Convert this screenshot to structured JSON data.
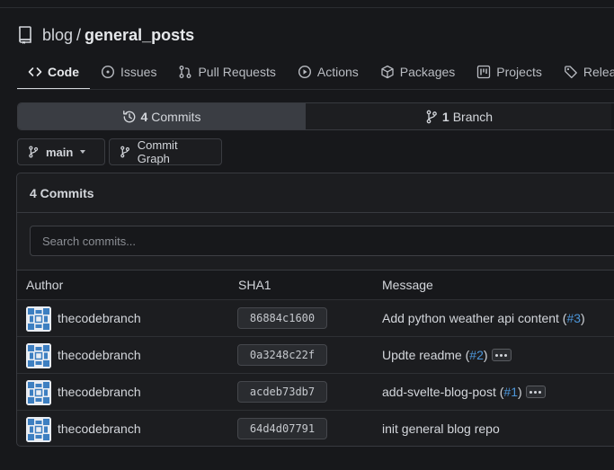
{
  "repo": {
    "owner": "blog",
    "separator": "/",
    "name": "general_posts",
    "icon": "repo-icon"
  },
  "tabs": [
    {
      "label": "Code",
      "icon": "code-icon",
      "active": true
    },
    {
      "label": "Issues",
      "icon": "issue-icon"
    },
    {
      "label": "Pull Requests",
      "icon": "pull-request-icon"
    },
    {
      "label": "Actions",
      "icon": "play-icon"
    },
    {
      "label": "Packages",
      "icon": "package-icon"
    },
    {
      "label": "Projects",
      "icon": "project-icon"
    },
    {
      "label": "Releases",
      "icon": "tag-icon"
    }
  ],
  "stats": {
    "commits": {
      "count": "4",
      "label": "Commits",
      "icon": "history-icon"
    },
    "branches": {
      "count": "1",
      "label": "Branch",
      "icon": "branch-icon"
    }
  },
  "branch_selector": {
    "label": "main",
    "icon": "branch-icon"
  },
  "commit_graph": {
    "label": "Commit Graph",
    "icon": "git-graph-icon"
  },
  "panel": {
    "title": "4 Commits",
    "search_placeholder": "Search commits...",
    "columns": {
      "author": "Author",
      "sha": "SHA1",
      "message": "Message"
    }
  },
  "commits": [
    {
      "author": "thecodebranch",
      "sha": "86884c1600",
      "message": "Add python weather api content (",
      "issue": "#3",
      "suffix": ")",
      "has_body": false
    },
    {
      "author": "thecodebranch",
      "sha": "0a3248c22f",
      "message": "Updte readme (",
      "issue": "#2",
      "suffix": ")",
      "has_body": true
    },
    {
      "author": "thecodebranch",
      "sha": "acdeb73db7",
      "message": "add-svelte-blog-post (",
      "issue": "#1",
      "suffix": ")",
      "has_body": true
    },
    {
      "author": "thecodebranch",
      "sha": "64d4d07791",
      "message": "init general blog repo",
      "issue": "",
      "suffix": "",
      "has_body": false
    }
  ]
}
